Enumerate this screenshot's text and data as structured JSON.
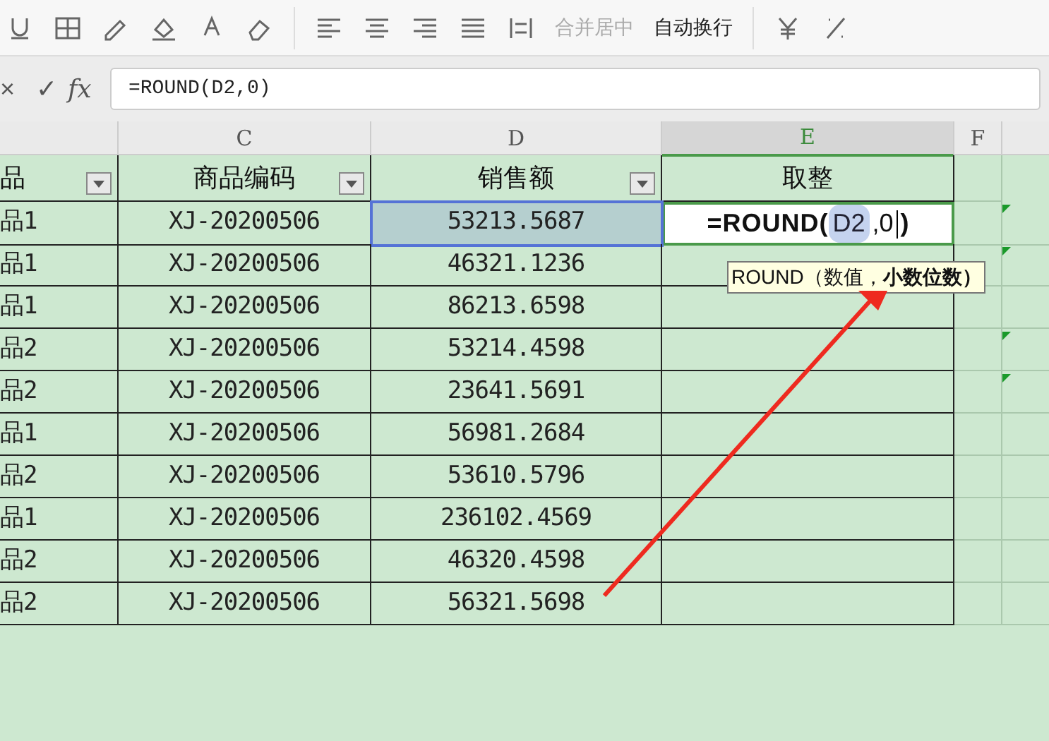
{
  "toolbar": {
    "buttons": [
      {
        "label": "合并居中",
        "disabled": true
      },
      {
        "label": "自动换行",
        "disabled": false
      }
    ]
  },
  "formula_bar": {
    "cancel": "×",
    "confirm": "✓",
    "fx": "fx",
    "value": "=ROUND(D2,0)"
  },
  "column_headers": [
    {
      "label": "C",
      "selected": false
    },
    {
      "label": "D",
      "selected": false
    },
    {
      "label": "E",
      "selected": true
    },
    {
      "label": "F",
      "selected": false
    }
  ],
  "header_row": [
    {
      "text": "品",
      "filter": true
    },
    {
      "text": "商品编码",
      "filter": true
    },
    {
      "text": "销售额",
      "filter": true
    },
    {
      "text": "取整",
      "filter": false
    }
  ],
  "rows": [
    {
      "cells": [
        "品1",
        "XJ-20200506",
        "53213.5687"
      ],
      "marker": true
    },
    {
      "cells": [
        "品1",
        "XJ-20200506",
        "46321.1236"
      ],
      "marker": true
    },
    {
      "cells": [
        "品1",
        "XJ-20200506",
        "86213.6598"
      ],
      "marker": false
    },
    {
      "cells": [
        "品2",
        "XJ-20200506",
        "53214.4598"
      ],
      "marker": true
    },
    {
      "cells": [
        "品2",
        "XJ-20200506",
        "23641.5691"
      ],
      "marker": true
    },
    {
      "cells": [
        "品1",
        "XJ-20200506",
        "56981.2684"
      ],
      "marker": false
    },
    {
      "cells": [
        "品2",
        "XJ-20200506",
        "53610.5796"
      ],
      "marker": false
    },
    {
      "cells": [
        "品1",
        "XJ-20200506",
        "236102.4569"
      ],
      "marker": false
    },
    {
      "cells": [
        "品2",
        "XJ-20200506",
        "46320.4598"
      ],
      "marker": false
    },
    {
      "cells": [
        "品2",
        "XJ-20200506",
        "56321.5698"
      ],
      "marker": false
    }
  ],
  "editing_cell": {
    "parts": [
      {
        "kind": "function",
        "text": "=ROUND("
      },
      {
        "kind": "reference",
        "text": "D2"
      },
      {
        "kind": "plain",
        "text": ",0"
      },
      {
        "kind": "caret"
      },
      {
        "kind": "function",
        "text": ")"
      }
    ]
  },
  "tooltip": "ROUND（数值，**小数位数）**"
}
